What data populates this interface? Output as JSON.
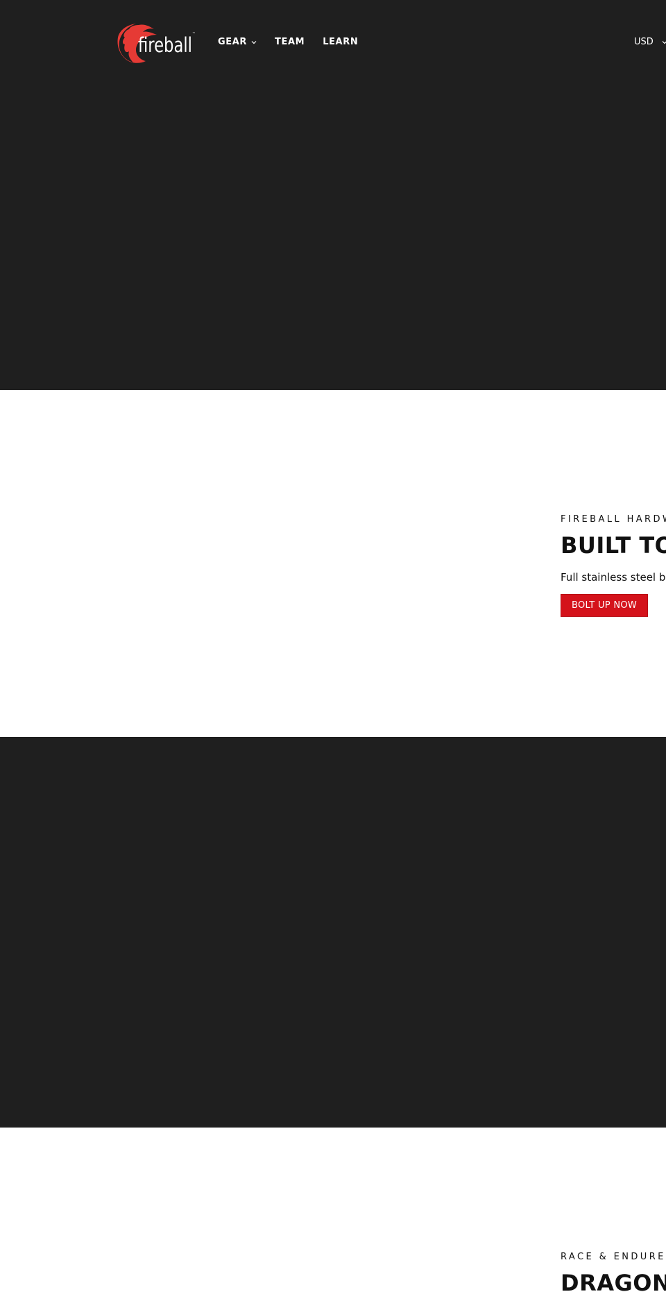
{
  "header": {
    "brand": "fireball",
    "brand_color": "#e63a35",
    "nav": [
      {
        "label": "GEAR",
        "has_dropdown": true
      },
      {
        "label": "TEAM",
        "has_dropdown": false
      },
      {
        "label": "LEARN",
        "has_dropdown": false
      }
    ],
    "currency": "USD"
  },
  "sections": [
    {
      "eyebrow": "FIREBALL HARDWA",
      "title": "BUILT TO",
      "body": "Full stainless steel bolt",
      "cta": "BOLT UP NOW"
    },
    {
      "eyebrow": "RACE & ENDURE",
      "title": "DRAGON B"
    }
  ],
  "colors": {
    "dark_bg": "#1f1f1f",
    "accent_red": "#d4121b"
  }
}
